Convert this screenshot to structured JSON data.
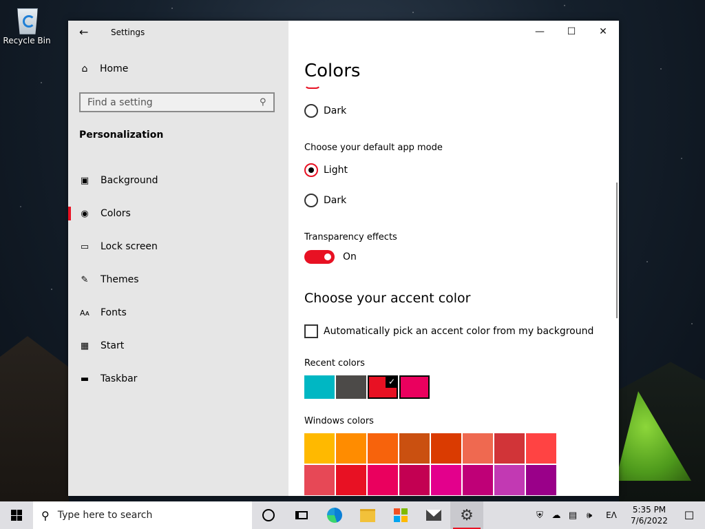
{
  "desktop": {
    "recycle_bin_label": "Recycle Bin"
  },
  "window": {
    "app_title": "Settings",
    "controls": {
      "minimize": "—",
      "maximize": "☐",
      "close": "✕"
    }
  },
  "sidebar": {
    "home_label": "Home",
    "search_placeholder": "Find a setting",
    "section_title": "Personalization",
    "items": [
      {
        "label": "Background",
        "icon": "image-icon"
      },
      {
        "label": "Colors",
        "icon": "palette-icon",
        "active": true
      },
      {
        "label": "Lock screen",
        "icon": "lock-screen-icon"
      },
      {
        "label": "Themes",
        "icon": "themes-icon"
      },
      {
        "label": "Fonts",
        "icon": "fonts-icon"
      },
      {
        "label": "Start",
        "icon": "start-icon"
      },
      {
        "label": "Taskbar",
        "icon": "taskbar-icon"
      }
    ]
  },
  "main": {
    "title": "Colors",
    "windows_mode_dark": "Dark",
    "app_mode_heading": "Choose your default app mode",
    "app_mode_light": "Light",
    "app_mode_dark": "Dark",
    "app_mode_selected": "Light",
    "transparency_heading": "Transparency effects",
    "transparency_state": "On",
    "accent_heading": "Choose your accent color",
    "auto_accent_label": "Automatically pick an accent color from my background",
    "auto_accent_checked": false,
    "recent_heading": "Recent colors",
    "recent_colors": [
      "#00b7c3",
      "#4c4a48",
      "#e81123",
      "#ea005e"
    ],
    "recent_selected_index": 2,
    "windows_heading": "Windows colors",
    "windows_colors": [
      "#ffb900",
      "#ff8c00",
      "#f7630c",
      "#ca5010",
      "#da3b01",
      "#ef6950",
      "#d13438",
      "#ff4343",
      "#e74856",
      "#e81123",
      "#ea005e",
      "#c30052",
      "#e3008c",
      "#bf0077",
      "#c239b3",
      "#9a0089"
    ]
  },
  "taskbar": {
    "search_placeholder": "Type here to search",
    "language": "EΛ",
    "time": "5:35 PM",
    "date": "7/6/2022"
  },
  "colors": {
    "accent": "#e81123"
  }
}
